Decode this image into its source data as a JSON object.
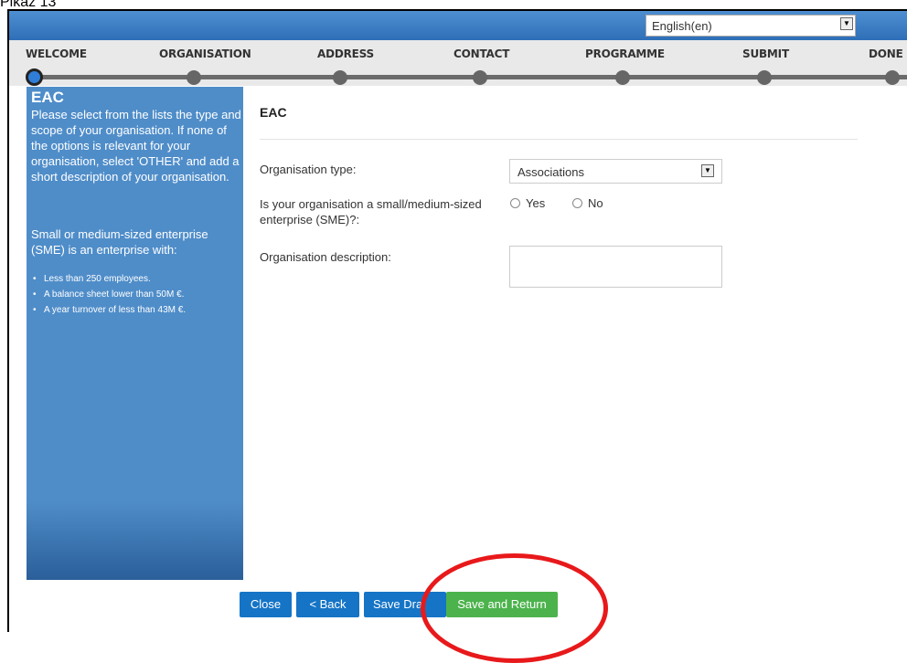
{
  "caption": "Pikaz 13",
  "header": {
    "language": "English(en)"
  },
  "steps": [
    "WELCOME",
    "ORGANISATION",
    "ADDRESS",
    "CONTACT",
    "PROGRAMME",
    "SUBMIT",
    "DONE"
  ],
  "sidebar": {
    "title": "EAC",
    "paragraph1": "Please select from the lists the type and scope of your organisation. If none of the options is relevant for your organisation, select 'OTHER' and add a short description of your organisation.",
    "paragraph2": "Small or medium-sized enterprise (SME) is an enterprise with:",
    "bullets": [
      "Less than 250 employees.",
      "A balance sheet lower than 50M €.",
      "A year turnover of less than 43M €."
    ]
  },
  "form": {
    "title": "EAC",
    "org_type_label": "Organisation type:",
    "org_type_value": "Associations",
    "sme_label": "Is your organisation a small/medium-sized enterprise (SME)?:",
    "sme_yes": "Yes",
    "sme_no": "No",
    "description_label": "Organisation description:",
    "description_value": ""
  },
  "buttons": {
    "close": "Close",
    "back": "< Back",
    "save_draft": "Save Dra",
    "save_return": "Save and Return"
  },
  "colors": {
    "header": "#2f6fb7",
    "sidebar": "#4f8dc9",
    "primary_button": "#1574c6",
    "success_button": "#4cb34c",
    "annotation": "#e8191b"
  }
}
